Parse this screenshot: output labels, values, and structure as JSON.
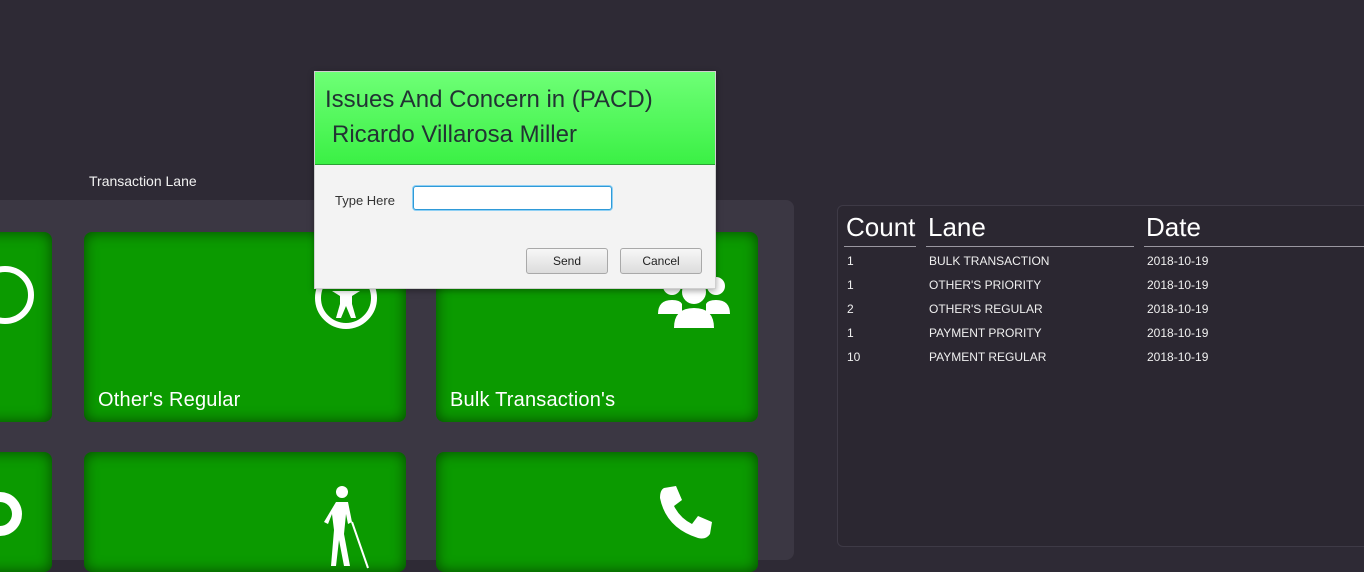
{
  "lanes": {
    "caption": "Transaction Lane",
    "tiles": [
      {
        "label": "",
        "icon": "person-icon"
      },
      {
        "label": "Other's Regular",
        "icon": "accessibility-icon"
      },
      {
        "label": "Bulk Transaction's",
        "icon": "group-icon"
      },
      {
        "label": "",
        "icon": "person-icon"
      },
      {
        "label": "",
        "icon": "blind-person-icon"
      },
      {
        "label": "",
        "icon": "phone-icon"
      }
    ]
  },
  "log": {
    "headers": {
      "count": "Count",
      "lane": "Lane",
      "date": "Date"
    },
    "rows": [
      {
        "count": "1",
        "lane": "BULK TRANSACTION",
        "date": "2018-10-19"
      },
      {
        "count": "1",
        "lane": "OTHER'S PRIORITY",
        "date": "2018-10-19"
      },
      {
        "count": "2",
        "lane": "OTHER'S REGULAR",
        "date": "2018-10-19"
      },
      {
        "count": "1",
        "lane": "PAYMENT PRORITY",
        "date": "2018-10-19"
      },
      {
        "count": "10",
        "lane": "PAYMENT REGULAR",
        "date": "2018-10-19"
      }
    ]
  },
  "dialog": {
    "title_line1": "Issues And Concern in (PACD)",
    "title_line2": "Ricardo Villarosa Miller",
    "field_label": "Type Here",
    "field_value": "",
    "send_label": "Send",
    "cancel_label": "Cancel"
  },
  "colors": {
    "tile": "#0b9a00",
    "dialog_header": "#4cf554",
    "background": "#2e2a35"
  }
}
